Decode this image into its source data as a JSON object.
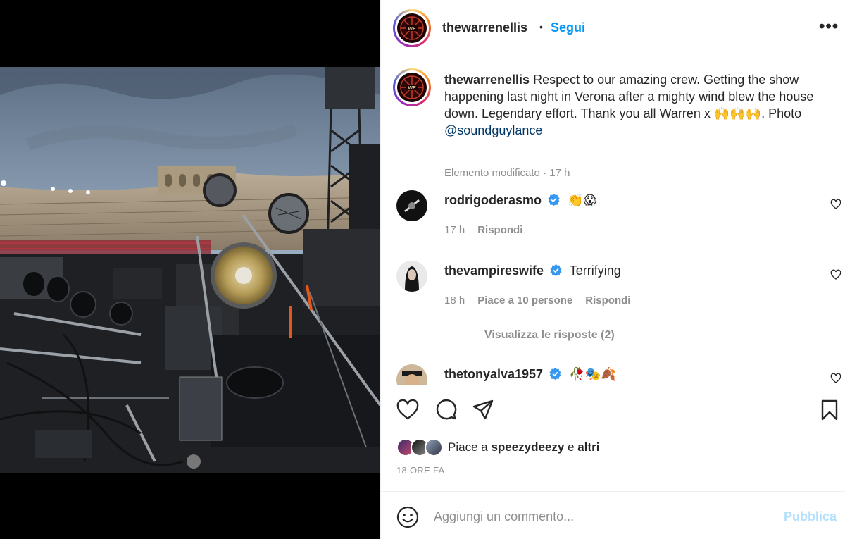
{
  "post": {
    "author": "thewarrenellis",
    "follow_label": "Segui",
    "more_label": "•••",
    "separator": "•"
  },
  "caption": {
    "username": "thewarrenellis",
    "text": " Respect to our amazing crew. Getting the show happening last night in Verona after a mighty wind blew the house down. Legendary effort. Thank you all Warren x 🙌🙌🙌. Photo ",
    "mention": "@soundguylance",
    "meta": "Elemento modificato · 17 h"
  },
  "comments": [
    {
      "username": "rodrigoderasmo",
      "text": "👏😱",
      "time": "17 h",
      "likes": "",
      "reply": "Rispondi"
    },
    {
      "username": "thevampireswife",
      "text": "Terrifying",
      "time": "18 h",
      "likes": "Piace a 10 persone",
      "reply": "Rispondi"
    },
    {
      "username": "thetonyalva1957",
      "text": "🥀🎭🍂",
      "time": "",
      "likes": "",
      "reply": ""
    }
  ],
  "view_replies": "Visualizza le risposte (2)",
  "likes": {
    "prefix": "Piace a ",
    "user": "speezydeezy",
    "mid": " e ",
    "others": "altri"
  },
  "time_ago": "18 ORE FA",
  "add_comment": {
    "placeholder": "Aggiungi un commento...",
    "publish_label": "Pubblica"
  },
  "colors": {
    "accent": "#0095f6",
    "verified": "#3897f0",
    "publish_disabled": "#b2dffc"
  },
  "icons": [
    "heart-icon",
    "comment-icon",
    "share-icon",
    "bookmark-icon",
    "emoji-icon",
    "verified-icon",
    "more-icon"
  ]
}
